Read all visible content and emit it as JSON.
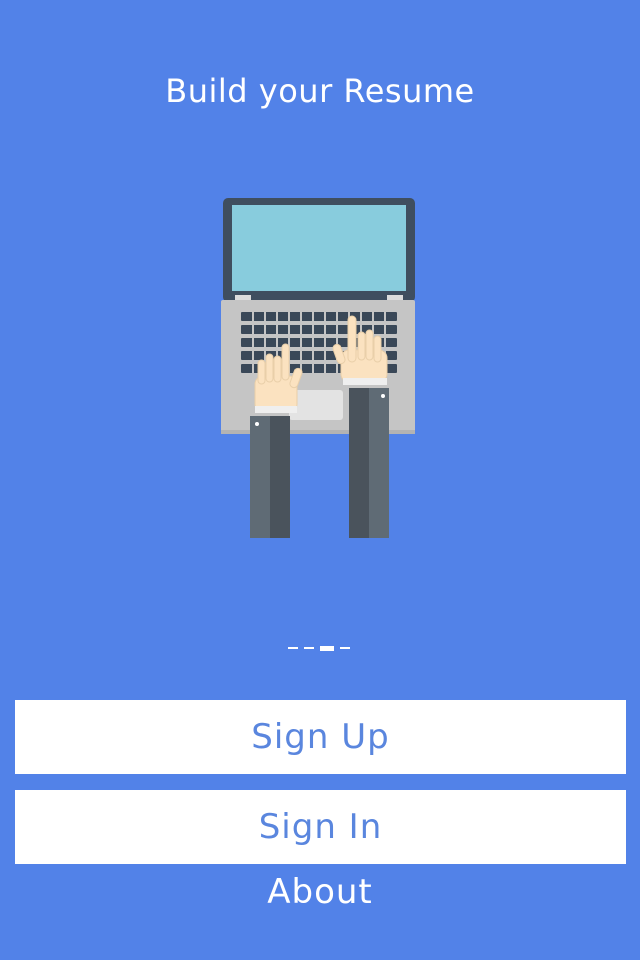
{
  "header": {
    "title": "Build your Resume"
  },
  "illustration": {
    "icon": "laptop-typing-illustration"
  },
  "pager": {
    "count": 4,
    "active_index": 2
  },
  "actions": {
    "sign_up_label": "Sign Up",
    "sign_in_label": "Sign In",
    "about_label": "About"
  },
  "colors": {
    "background": "#5282E8",
    "button_bg": "#FFFFFF",
    "button_text": "#5A86DE",
    "text_light": "#FFFFFF"
  }
}
